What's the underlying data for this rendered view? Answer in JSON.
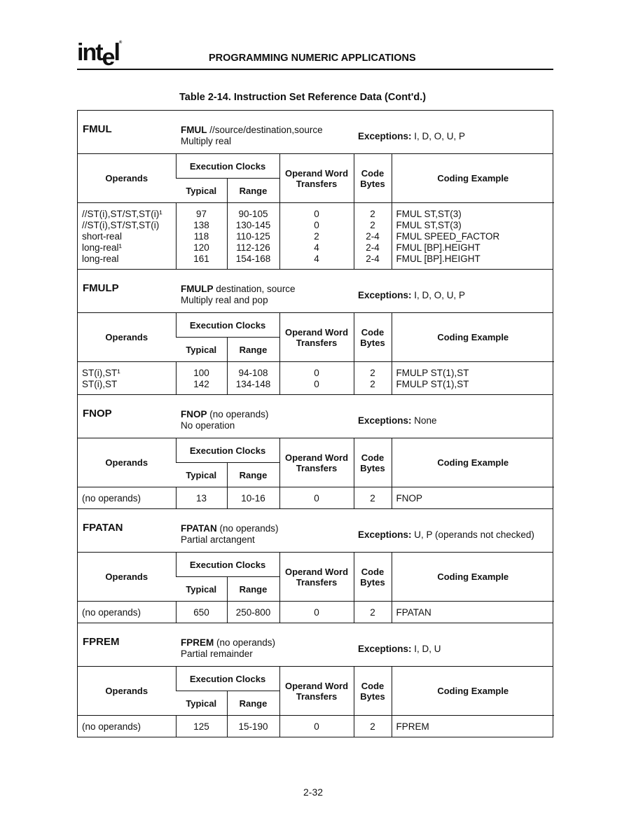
{
  "header": {
    "logo": "intel",
    "running_title": "PROGRAMMING NUMERIC APPLICATIONS",
    "table_caption": "Table 2-14.  Instruction Set Reference Data (Cont'd.)"
  },
  "columns": {
    "operands": "Operands",
    "execution_clocks": "Execution Clocks",
    "typical": "Typical",
    "range": "Range",
    "operand_word_transfers": [
      "Operand Word",
      "Transfers"
    ],
    "code_bytes": [
      "Code",
      "Bytes"
    ],
    "coding_example": "Coding Example"
  },
  "exceptions_label": "Exceptions:",
  "sections": [
    {
      "mnemonic": "FMUL",
      "syntax_mnemonic": "FMUL",
      "syntax_rest": " //source/destination,source",
      "description": "Multiply real",
      "exceptions": "I, D, O, U, P",
      "rows": [
        [
          "//ST(i),ST/ST,ST(i)¹",
          "97",
          "90-105",
          "0",
          "2",
          "FMUL  ST,ST(3)"
        ],
        [
          "//ST(i),ST/ST,ST(i)",
          "138",
          "130-145",
          "0",
          "2",
          "FMUL  ST,ST(3)"
        ],
        [
          "short-real",
          "118",
          "110-125",
          "2",
          "2-4",
          "FMUL  SPEED_FACTOR"
        ],
        [
          "long-real¹",
          "120",
          "112-126",
          "4",
          "2-4",
          "FMUL  [BP].HEIGHT"
        ],
        [
          "long-real",
          "161",
          "154-168",
          "4",
          "2-4",
          "FMUL  [BP].HEIGHT"
        ]
      ]
    },
    {
      "mnemonic": "FMULP",
      "syntax_mnemonic": "FMULP",
      "syntax_rest": " destination, source",
      "description": "Multiply real and pop",
      "exceptions": "I, D, O, U, P",
      "rows": [
        [
          "ST(i),ST¹",
          "100",
          "94-108",
          "0",
          "2",
          "FMULP  ST(1),ST"
        ],
        [
          "ST(i),ST",
          "142",
          "134-148",
          "0",
          "2",
          "FMULP  ST(1),ST"
        ]
      ]
    },
    {
      "mnemonic": "FNOP",
      "syntax_mnemonic": "FNOP",
      "syntax_rest": " (no operands)",
      "description": "No operation",
      "exceptions": "None",
      "rows": [
        [
          "(no operands)",
          "13",
          "10-16",
          "0",
          "2",
          "FNOP"
        ]
      ]
    },
    {
      "mnemonic": "FPATAN",
      "syntax_mnemonic": "FPATAN",
      "syntax_rest": " (no operands)",
      "description": "Partial arctangent",
      "exceptions": "U, P (operands not checked)",
      "rows": [
        [
          "(no operands)",
          "650",
          "250-800",
          "0",
          "2",
          "FPATAN"
        ]
      ]
    },
    {
      "mnemonic": "FPREM",
      "syntax_mnemonic": "FPREM",
      "syntax_rest": " (no operands)",
      "description": "Partial remainder",
      "exceptions": "I, D, U",
      "rows": [
        [
          "(no operands)",
          "125",
          "15-190",
          "0",
          "2",
          "FPREM"
        ]
      ]
    }
  ],
  "footer": {
    "page_number": "2-32"
  }
}
